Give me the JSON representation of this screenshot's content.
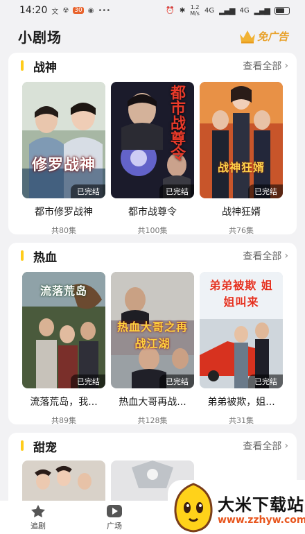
{
  "status_bar": {
    "time": "14:20",
    "app_icons": [
      "文",
      "☢",
      "30",
      "◉"
    ],
    "speed_value": "1.2",
    "speed_unit": "M/s",
    "network": "4G",
    "battery_level": 0.6,
    "battery_label": "52"
  },
  "header": {
    "title": "小剧场",
    "ad_free_label": "免广告"
  },
  "sections": [
    {
      "title": "战神",
      "see_all": "查看全部",
      "items": [
        {
          "title": "都市修罗战神",
          "episodes": "共80集",
          "badge": "已完结",
          "poster_text": "修罗战神"
        },
        {
          "title": "都市战尊令",
          "episodes": "共100集",
          "badge": "已完结",
          "poster_text": "都市战尊令"
        },
        {
          "title": "战神狂婿",
          "episodes": "共76集",
          "badge": "已完结",
          "poster_text": "战神狂婿"
        }
      ]
    },
    {
      "title": "热血",
      "see_all": "查看全部",
      "items": [
        {
          "title": "流落荒岛，我...",
          "episodes": "共89集",
          "badge": "已完结",
          "poster_text": "流落荒岛"
        },
        {
          "title": "热血大哥再战...",
          "episodes": "共128集",
          "badge": "已完结",
          "poster_text": "热血大哥之再战江湖"
        },
        {
          "title": "弟弟被欺，姐...",
          "episodes": "共31集",
          "badge": "已完结",
          "poster_text": "弟弟被欺 姐姐叫来"
        }
      ]
    },
    {
      "title": "甜宠",
      "see_all": "查看全部",
      "items": [
        {},
        {},
        {}
      ]
    }
  ],
  "tabs": [
    {
      "label": "追剧",
      "icon": "star-icon"
    },
    {
      "label": "广场",
      "icon": "play-icon"
    }
  ],
  "watermark": {
    "name": "大米下载站",
    "url": "www.zzhyw.com"
  }
}
